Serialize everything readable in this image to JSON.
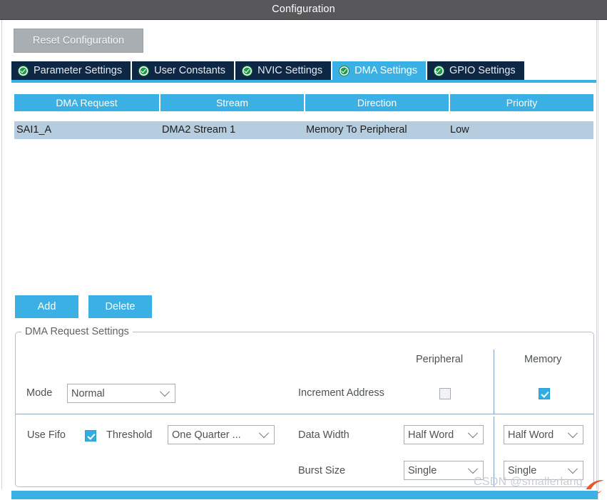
{
  "window": {
    "title": "Configuration"
  },
  "toolbar": {
    "reset_label": "Reset Configuration"
  },
  "tabs": [
    {
      "label": "Parameter Settings",
      "icon": "check-circle-icon",
      "active": false
    },
    {
      "label": "User Constants",
      "icon": "check-circle-icon",
      "active": false
    },
    {
      "label": "NVIC Settings",
      "icon": "check-circle-icon",
      "active": false
    },
    {
      "label": "DMA Settings",
      "icon": "check-circle-icon",
      "active": true
    },
    {
      "label": "GPIO Settings",
      "icon": "check-circle-icon",
      "active": false
    }
  ],
  "table": {
    "columns": [
      "DMA Request",
      "Stream",
      "Direction",
      "Priority"
    ],
    "rows": [
      {
        "dma_request": "SAI1_A",
        "stream": "DMA2 Stream 1",
        "direction": "Memory To Peripheral",
        "priority": "Low",
        "selected": true
      }
    ]
  },
  "actions": {
    "add_label": "Add",
    "delete_label": "Delete"
  },
  "settings": {
    "group_title": "DMA Request Settings",
    "column_headers": {
      "peripheral": "Peripheral",
      "memory": "Memory"
    },
    "mode": {
      "label": "Mode",
      "value": "Normal"
    },
    "increment_address": {
      "label": "Increment Address",
      "peripheral_checked": false,
      "memory_checked": true
    },
    "use_fifo": {
      "label": "Use Fifo",
      "checked": true
    },
    "threshold": {
      "label": "Threshold",
      "value": "One Quarter ..."
    },
    "data_width": {
      "label": "Data Width",
      "peripheral_value": "Half Word",
      "memory_value": "Half Word"
    },
    "burst_size": {
      "label": "Burst Size",
      "peripheral_value": "Single",
      "memory_value": "Single"
    }
  },
  "watermark": {
    "text": "CSDN @smallerlang"
  },
  "colors": {
    "titlebar": "#58585a",
    "accent_blue": "#3bb0e5",
    "tab_inactive": "#0d2744",
    "row_selected": "#b6cde0",
    "check_green": "#1f9a4a",
    "reset_gray": "#a9aeb2"
  }
}
